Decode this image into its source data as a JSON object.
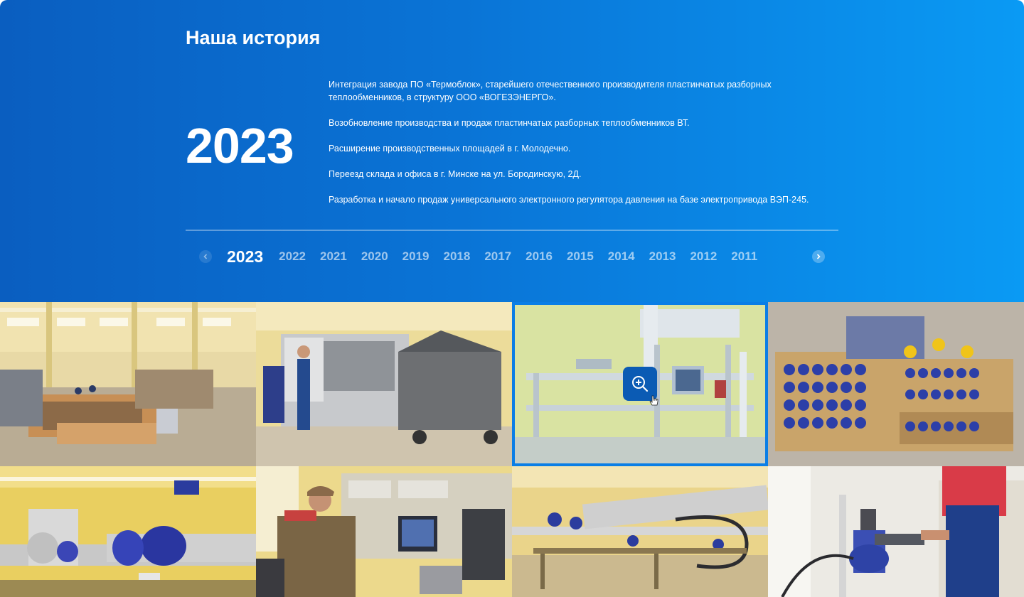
{
  "section": {
    "title": "Наша история"
  },
  "current_year": "2023",
  "events": [
    "Интеграция завода ПО «Термоблок», старейшего отечественного производителя пластинчатых разборных теплообменников, в структуру ООО «ВОГЕЗЭНЕРГО».",
    "Возобновление производства и продаж пластинчатых разборных теплообменников ВТ.",
    "Расширение производственных площадей в г. Молодечно.",
    "Переезд склада и офиса в г. Минске на ул. Бородинскую, 2Д.",
    "Разработка и начало продаж универсального электронного регулятора давления на базе электропривода ВЭП-245."
  ],
  "timeline": {
    "years": [
      "2023",
      "2022",
      "2021",
      "2020",
      "2019",
      "2018",
      "2017",
      "2016",
      "2015",
      "2014",
      "2013",
      "2012",
      "2011"
    ],
    "active_index": 0,
    "prev_icon": "chevron-left-icon",
    "next_icon": "chevron-right-icon"
  },
  "gallery": {
    "photos": [
      "workshop-hall-photo",
      "cnc-lathe-photo",
      "pipe-test-stand-photo",
      "valves-on-pallets-photo",
      "blue-valves-piping-photo",
      "worker-at-test-bench-photo",
      "test-line-hall-photo",
      "worker-assembling-valve-photo"
    ],
    "highlighted_index": 2,
    "zoom_icon": "zoom-in-icon",
    "cursor_icon": "hand-pointer-icon"
  },
  "colors": {
    "hero_start": "#0a5ec0",
    "hero_end": "#0a9af4",
    "accent": "#0b5bb4",
    "highlight_border": "#0a7ee6"
  }
}
